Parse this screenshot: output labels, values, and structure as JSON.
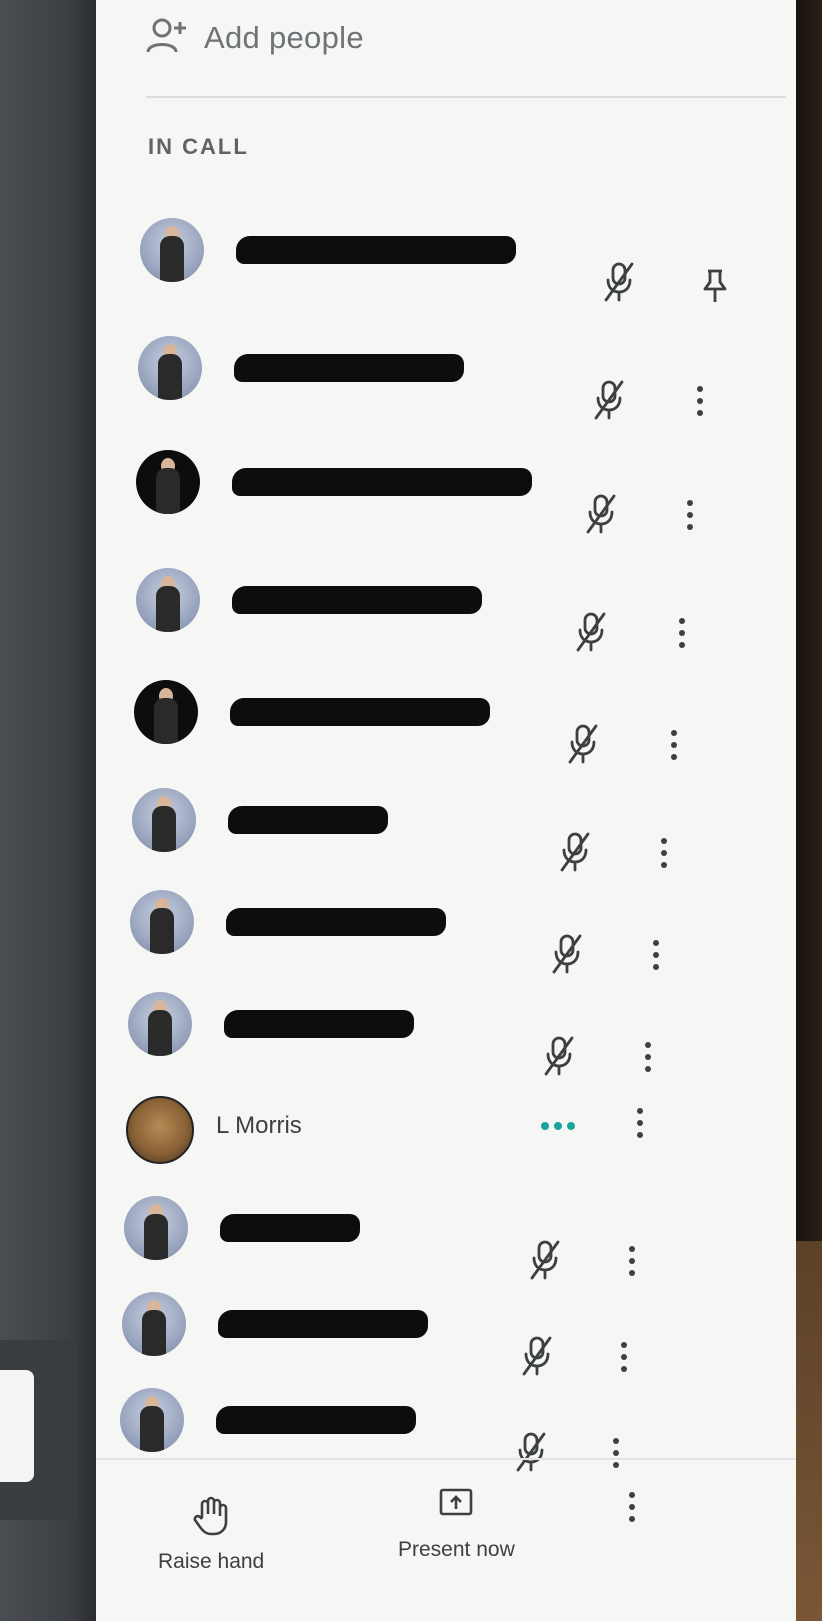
{
  "panel": {
    "add_people_label": "Add people",
    "section_title": "IN CALL"
  },
  "participants": [
    {
      "name": "",
      "name_redacted": true,
      "mic": "mic-off",
      "action": "pin"
    },
    {
      "name": "",
      "name_redacted": true,
      "mic": "mic-off",
      "action": "more"
    },
    {
      "name": "",
      "name_redacted": true,
      "mic": "mic-off",
      "action": "more"
    },
    {
      "name": "",
      "name_redacted": true,
      "mic": "mic-off",
      "action": "more"
    },
    {
      "name": "",
      "name_redacted": true,
      "mic": "mic-off",
      "action": "more"
    },
    {
      "name": "",
      "name_redacted": true,
      "mic": "mic-off",
      "action": "more"
    },
    {
      "name": "",
      "name_redacted": true,
      "mic": "mic-off",
      "action": "more"
    },
    {
      "name": "",
      "name_redacted": true,
      "mic": "mic-off",
      "action": "more"
    },
    {
      "name": "L Morris",
      "name_redacted": false,
      "mic": "speaking",
      "action": "more"
    },
    {
      "name": "",
      "name_redacted": true,
      "mic": "mic-off",
      "action": "more"
    },
    {
      "name": "",
      "name_redacted": true,
      "mic": "mic-off",
      "action": "more"
    },
    {
      "name": "",
      "name_redacted": true,
      "mic": "mic-off",
      "action": "more"
    }
  ],
  "bottom_bar": {
    "raise_hand_label": "Raise hand",
    "present_now_label": "Present now"
  },
  "colors": {
    "panel_bg": "#f6f6f4",
    "text": "#3c4043",
    "muted": "#6e7378",
    "speaking_accent": "#1aa39a",
    "redaction": "#0d0d0d"
  }
}
